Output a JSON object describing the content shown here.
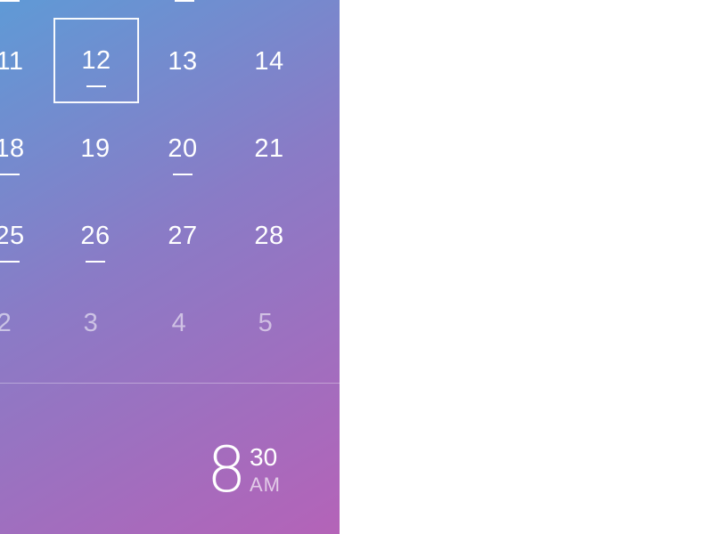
{
  "calendar": {
    "selected_day": "12",
    "rows": [
      [
        {
          "label": "11",
          "mark": false,
          "muted": false
        },
        {
          "label": "12",
          "mark": true,
          "muted": false,
          "selected": true
        },
        {
          "label": "13",
          "mark": false,
          "muted": false
        },
        {
          "label": "14",
          "mark": false,
          "muted": false
        }
      ],
      [
        {
          "label": "18",
          "mark": true,
          "muted": false
        },
        {
          "label": "19",
          "mark": false,
          "muted": false
        },
        {
          "label": "20",
          "mark": true,
          "muted": false
        },
        {
          "label": "21",
          "mark": false,
          "muted": false
        }
      ],
      [
        {
          "label": "25",
          "mark": true,
          "muted": false
        },
        {
          "label": "26",
          "mark": true,
          "muted": false
        },
        {
          "label": "27",
          "mark": false,
          "muted": false
        },
        {
          "label": "28",
          "mark": false,
          "muted": false
        }
      ],
      [
        {
          "label": "2",
          "mark": false,
          "muted": true
        },
        {
          "label": "3",
          "mark": false,
          "muted": true
        },
        {
          "label": "4",
          "mark": false,
          "muted": true
        },
        {
          "label": "5",
          "mark": false,
          "muted": true
        }
      ]
    ]
  },
  "time": {
    "hour": "8",
    "minutes": "30",
    "period": "AM"
  },
  "colors": {
    "gradient_start": "#5f9ad6",
    "gradient_mid": "#8a7bc6",
    "gradient_end": "#b463b8",
    "text": "#ffffff"
  }
}
